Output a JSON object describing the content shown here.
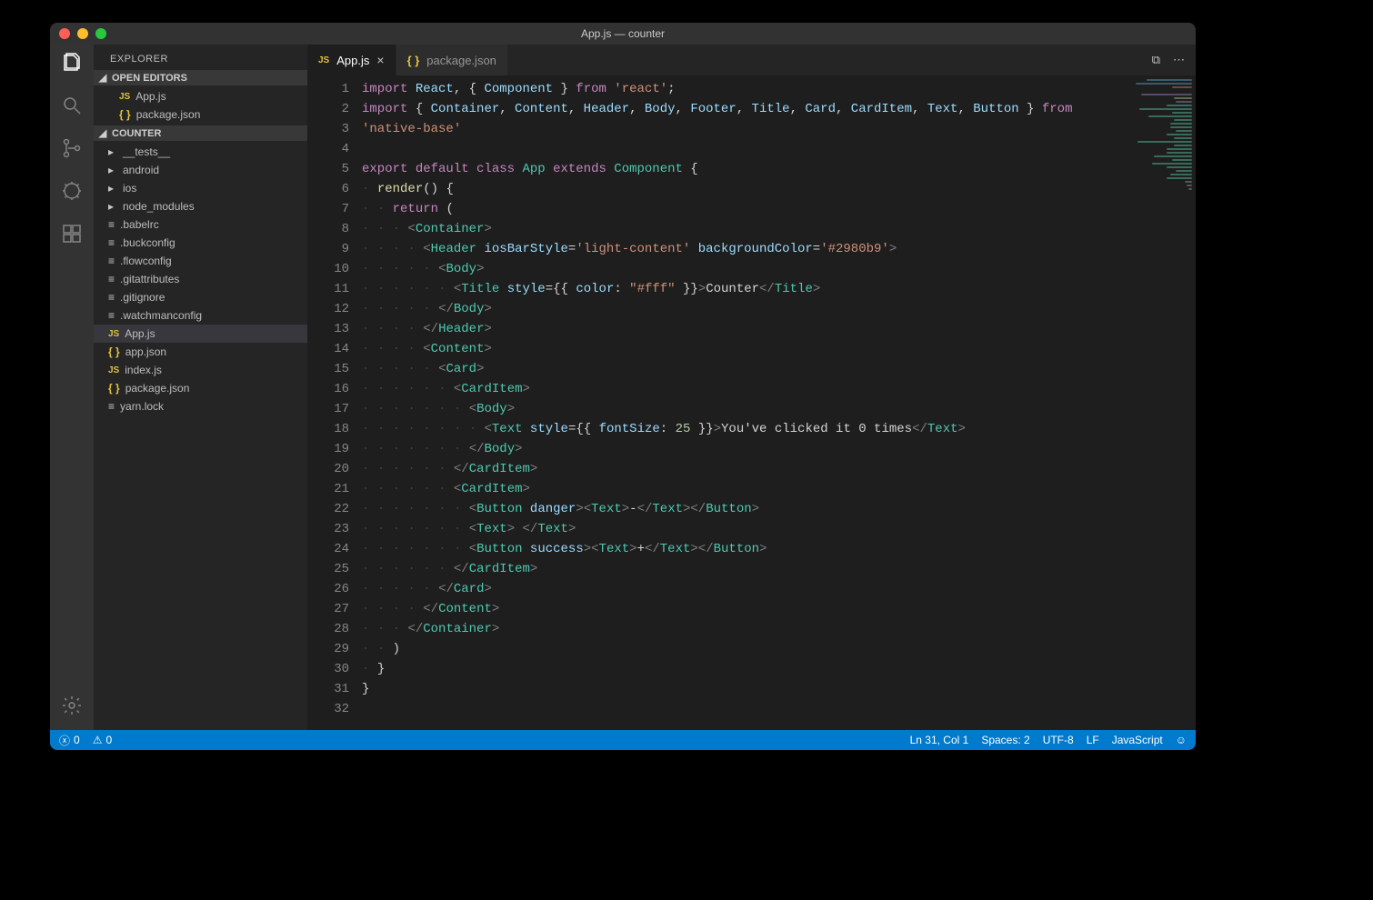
{
  "window": {
    "title": "App.js — counter"
  },
  "sidebar": {
    "title": "EXPLORER",
    "openEditors": {
      "header": "OPEN EDITORS",
      "items": [
        {
          "label": "App.js",
          "kind": "js"
        },
        {
          "label": "package.json",
          "kind": "json"
        }
      ]
    },
    "workspace": {
      "header": "COUNTER",
      "items": [
        {
          "label": "__tests__",
          "kind": "folder"
        },
        {
          "label": "android",
          "kind": "folder"
        },
        {
          "label": "ios",
          "kind": "folder"
        },
        {
          "label": "node_modules",
          "kind": "folder"
        },
        {
          "label": ".babelrc",
          "kind": "file"
        },
        {
          "label": ".buckconfig",
          "kind": "file"
        },
        {
          "label": ".flowconfig",
          "kind": "file"
        },
        {
          "label": ".gitattributes",
          "kind": "file"
        },
        {
          "label": ".gitignore",
          "kind": "file"
        },
        {
          "label": ".watchmanconfig",
          "kind": "file"
        },
        {
          "label": "App.js",
          "kind": "js",
          "selected": true
        },
        {
          "label": "app.json",
          "kind": "json"
        },
        {
          "label": "index.js",
          "kind": "js"
        },
        {
          "label": "package.json",
          "kind": "json"
        },
        {
          "label": "yarn.lock",
          "kind": "file"
        }
      ]
    }
  },
  "tabs": [
    {
      "label": "App.js",
      "kind": "js",
      "active": true,
      "closeable": true
    },
    {
      "label": "package.json",
      "kind": "json",
      "active": false,
      "closeable": false
    }
  ],
  "code": {
    "lines": [
      [
        [
          "kw",
          "import"
        ],
        [
          "",
          ""
        ],
        [
          "var",
          " React"
        ],
        [
          "punc",
          ","
        ],
        [
          "",
          ""
        ],
        [
          "punc",
          " {"
        ],
        [
          "",
          ""
        ],
        [
          "var",
          " Component"
        ],
        [
          "",
          ""
        ],
        [
          "punc",
          " }"
        ],
        [
          "",
          ""
        ],
        [
          "kw",
          " from"
        ],
        [
          "",
          ""
        ],
        [
          "str",
          " 'react'"
        ],
        [
          "punc",
          ";"
        ]
      ],
      [
        [
          "kw",
          "import"
        ],
        [
          "",
          ""
        ],
        [
          "punc",
          " {"
        ],
        [
          "var",
          " Container"
        ],
        [
          "punc",
          ","
        ],
        [
          "var",
          " Content"
        ],
        [
          "punc",
          ","
        ],
        [
          "var",
          " Header"
        ],
        [
          "punc",
          ","
        ],
        [
          "var",
          " Body"
        ],
        [
          "punc",
          ","
        ],
        [
          "var",
          " Footer"
        ],
        [
          "punc",
          ","
        ],
        [
          "var",
          " Title"
        ],
        [
          "punc",
          ","
        ],
        [
          "var",
          " Card"
        ],
        [
          "punc",
          ","
        ],
        [
          "var",
          " CardItem"
        ],
        [
          "punc",
          ","
        ],
        [
          "var",
          " Text"
        ],
        [
          "punc",
          ","
        ],
        [
          "var",
          " Button"
        ],
        [
          "punc",
          " }"
        ],
        [
          "kw",
          " from"
        ]
      ],
      [
        [
          "str",
          "'native-base'"
        ]
      ],
      [
        [
          "",
          ""
        ]
      ],
      [
        [
          "kw",
          "export"
        ],
        [
          "kw",
          " default"
        ],
        [
          "kw",
          " class"
        ],
        [
          "type",
          " App"
        ],
        [
          "kw",
          " extends"
        ],
        [
          "type",
          " Component"
        ],
        [
          "punc",
          " {"
        ]
      ],
      [
        [
          "",
          "  "
        ],
        [
          "fn",
          "render"
        ],
        [
          "punc",
          "()"
        ],
        [
          "punc",
          " {"
        ]
      ],
      [
        [
          "",
          "    "
        ],
        [
          "kw",
          "return"
        ],
        [
          "punc",
          " ("
        ]
      ],
      [
        [
          "",
          "      "
        ],
        [
          "br",
          "<"
        ],
        [
          "tag",
          "Container"
        ],
        [
          "br",
          ">"
        ]
      ],
      [
        [
          "",
          "        "
        ],
        [
          "br",
          "<"
        ],
        [
          "tag",
          "Header"
        ],
        [
          "",
          " "
        ],
        [
          "attr",
          "iosBarStyle"
        ],
        [
          "op",
          "="
        ],
        [
          "str",
          "'light-content'"
        ],
        [
          "",
          " "
        ],
        [
          "attr",
          "backgroundColor"
        ],
        [
          "op",
          "="
        ],
        [
          "str",
          "'#2980b9'"
        ],
        [
          "br",
          ">"
        ]
      ],
      [
        [
          "",
          "          "
        ],
        [
          "br",
          "<"
        ],
        [
          "tag",
          "Body"
        ],
        [
          "br",
          ">"
        ]
      ],
      [
        [
          "",
          "            "
        ],
        [
          "br",
          "<"
        ],
        [
          "tag",
          "Title"
        ],
        [
          "",
          " "
        ],
        [
          "attr",
          "style"
        ],
        [
          "op",
          "="
        ],
        [
          "punc",
          "{{"
        ],
        [
          "",
          " "
        ],
        [
          "var",
          "color"
        ],
        [
          "punc",
          ":"
        ],
        [
          "",
          " "
        ],
        [
          "str",
          "\"#fff\""
        ],
        [
          "",
          " "
        ],
        [
          "punc",
          "}}"
        ],
        [
          "br",
          ">"
        ],
        [
          "",
          "Counter"
        ],
        [
          "br",
          "</"
        ],
        [
          "tag",
          "Title"
        ],
        [
          "br",
          ">"
        ]
      ],
      [
        [
          "",
          "          "
        ],
        [
          "br",
          "</"
        ],
        [
          "tag",
          "Body"
        ],
        [
          "br",
          ">"
        ]
      ],
      [
        [
          "",
          "        "
        ],
        [
          "br",
          "</"
        ],
        [
          "tag",
          "Header"
        ],
        [
          "br",
          ">"
        ]
      ],
      [
        [
          "",
          "        "
        ],
        [
          "br",
          "<"
        ],
        [
          "tag",
          "Content"
        ],
        [
          "br",
          ">"
        ]
      ],
      [
        [
          "",
          "          "
        ],
        [
          "br",
          "<"
        ],
        [
          "tag",
          "Card"
        ],
        [
          "br",
          ">"
        ]
      ],
      [
        [
          "",
          "            "
        ],
        [
          "br",
          "<"
        ],
        [
          "tag",
          "CardItem"
        ],
        [
          "br",
          ">"
        ]
      ],
      [
        [
          "",
          "              "
        ],
        [
          "br",
          "<"
        ],
        [
          "tag",
          "Body"
        ],
        [
          "br",
          ">"
        ]
      ],
      [
        [
          "",
          "                "
        ],
        [
          "br",
          "<"
        ],
        [
          "tag",
          "Text"
        ],
        [
          "",
          " "
        ],
        [
          "attr",
          "style"
        ],
        [
          "op",
          "="
        ],
        [
          "punc",
          "{{"
        ],
        [
          "",
          " "
        ],
        [
          "var",
          "fontSize"
        ],
        [
          "punc",
          ":"
        ],
        [
          "",
          " "
        ],
        [
          "num",
          "25"
        ],
        [
          "",
          " "
        ],
        [
          "punc",
          "}}"
        ],
        [
          "br",
          ">"
        ],
        [
          "",
          "You've clicked it 0 times"
        ],
        [
          "br",
          "</"
        ],
        [
          "tag",
          "Text"
        ],
        [
          "br",
          ">"
        ]
      ],
      [
        [
          "",
          "              "
        ],
        [
          "br",
          "</"
        ],
        [
          "tag",
          "Body"
        ],
        [
          "br",
          ">"
        ]
      ],
      [
        [
          "",
          "            "
        ],
        [
          "br",
          "</"
        ],
        [
          "tag",
          "CardItem"
        ],
        [
          "br",
          ">"
        ]
      ],
      [
        [
          "",
          "            "
        ],
        [
          "br",
          "<"
        ],
        [
          "tag",
          "CardItem"
        ],
        [
          "br",
          ">"
        ]
      ],
      [
        [
          "",
          "              "
        ],
        [
          "br",
          "<"
        ],
        [
          "tag",
          "Button"
        ],
        [
          "",
          " "
        ],
        [
          "attr",
          "danger"
        ],
        [
          "br",
          ">"
        ],
        [
          "br",
          "<"
        ],
        [
          "tag",
          "Text"
        ],
        [
          "br",
          ">"
        ],
        [
          "",
          "-"
        ],
        [
          "br",
          "</"
        ],
        [
          "tag",
          "Text"
        ],
        [
          "br",
          ">"
        ],
        [
          "br",
          "</"
        ],
        [
          "tag",
          "Button"
        ],
        [
          "br",
          ">"
        ]
      ],
      [
        [
          "",
          "              "
        ],
        [
          "br",
          "<"
        ],
        [
          "tag",
          "Text"
        ],
        [
          "br",
          ">"
        ],
        [
          "",
          " "
        ],
        [
          "br",
          "</"
        ],
        [
          "tag",
          "Text"
        ],
        [
          "br",
          ">"
        ]
      ],
      [
        [
          "",
          "              "
        ],
        [
          "br",
          "<"
        ],
        [
          "tag",
          "Button"
        ],
        [
          "",
          " "
        ],
        [
          "attr",
          "success"
        ],
        [
          "br",
          ">"
        ],
        [
          "br",
          "<"
        ],
        [
          "tag",
          "Text"
        ],
        [
          "br",
          ">"
        ],
        [
          "",
          "+"
        ],
        [
          "br",
          "</"
        ],
        [
          "tag",
          "Text"
        ],
        [
          "br",
          ">"
        ],
        [
          "br",
          "</"
        ],
        [
          "tag",
          "Button"
        ],
        [
          "br",
          ">"
        ]
      ],
      [
        [
          "",
          "            "
        ],
        [
          "br",
          "</"
        ],
        [
          "tag",
          "CardItem"
        ],
        [
          "br",
          ">"
        ]
      ],
      [
        [
          "",
          "          "
        ],
        [
          "br",
          "</"
        ],
        [
          "tag",
          "Card"
        ],
        [
          "br",
          ">"
        ]
      ],
      [
        [
          "",
          "        "
        ],
        [
          "br",
          "</"
        ],
        [
          "tag",
          "Content"
        ],
        [
          "br",
          ">"
        ]
      ],
      [
        [
          "",
          "      "
        ],
        [
          "br",
          "</"
        ],
        [
          "tag",
          "Container"
        ],
        [
          "br",
          ">"
        ]
      ],
      [
        [
          "",
          "    "
        ],
        [
          "punc",
          ")"
        ]
      ],
      [
        [
          "",
          "  "
        ],
        [
          "punc",
          "}"
        ]
      ],
      [
        [
          "punc",
          "}"
        ]
      ],
      [
        [
          "",
          ""
        ]
      ]
    ]
  },
  "status": {
    "errors": "0",
    "warnings": "0",
    "position": "Ln 31, Col 1",
    "spaces": "Spaces: 2",
    "encoding": "UTF-8",
    "eol": "LF",
    "language": "JavaScript"
  },
  "tabActions": {
    "close": "×",
    "split": "⧉",
    "more": "⋯"
  }
}
